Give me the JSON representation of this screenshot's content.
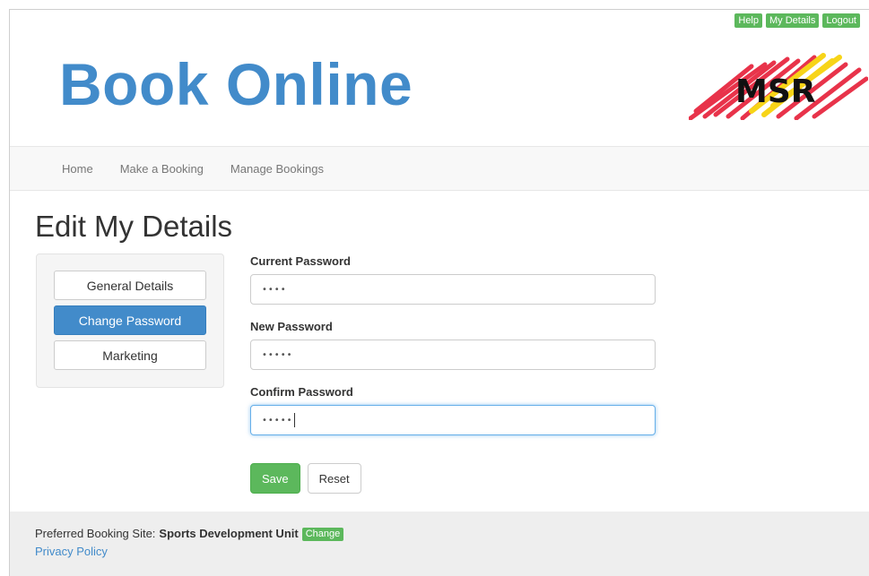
{
  "toplinks": {
    "help": "Help",
    "my_details": "My Details",
    "logout": "Logout"
  },
  "brand": {
    "title": "Book Online",
    "logo_text": "MSR"
  },
  "nav": {
    "home": "Home",
    "make_booking": "Make a Booking",
    "manage_bookings": "Manage Bookings"
  },
  "page": {
    "title": "Edit My Details"
  },
  "sidebar": {
    "items": [
      {
        "label": "General Details",
        "active": false
      },
      {
        "label": "Change Password",
        "active": true
      },
      {
        "label": "Marketing",
        "active": false
      }
    ]
  },
  "form": {
    "current_label": "Current Password",
    "current_value": "••••",
    "new_label": "New Password",
    "new_value": "•••••",
    "confirm_label": "Confirm Password",
    "confirm_value": "•••••",
    "save": "Save",
    "reset": "Reset"
  },
  "footer": {
    "preferred_label": "Preferred Booking Site:",
    "site_name": "Sports Development Unit",
    "change": "Change",
    "privacy": "Privacy Policy"
  },
  "colors": {
    "primary": "#428bca",
    "success": "#5cb85c",
    "logo_red": "#e8334a",
    "logo_yellow": "#f7d418"
  }
}
